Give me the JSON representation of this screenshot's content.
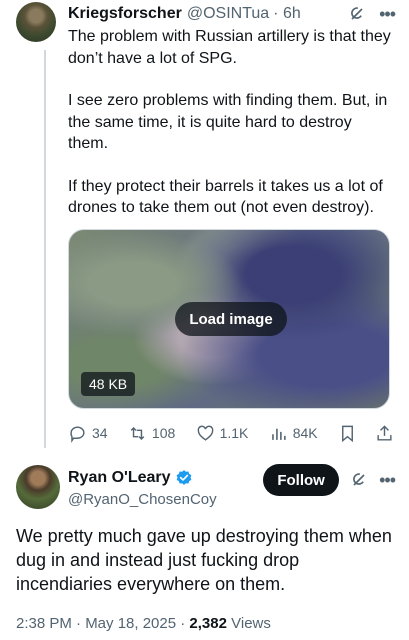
{
  "tweet": {
    "author_name": "Kriegsforscher",
    "author_handle": "@OSINTua",
    "time": "· 6h",
    "paragraphs": [
      "The problem with Russian artillery is that they don’t have a lot of SPG.",
      "I see zero problems with finding them. But, in the same time, it is quite hard to destroy them.",
      "If they protect their barrels it takes us a lot of drones to take them out (not even destroy)."
    ],
    "media": {
      "load_label": "Load image",
      "size": "48 KB"
    },
    "actions": {
      "replies": "34",
      "reposts": "108",
      "likes": "1.1K",
      "views": "84K"
    },
    "icons": [
      "grok-icon",
      "more-icon",
      "reply-icon",
      "repost-icon",
      "like-icon",
      "views-icon",
      "bookmark-icon",
      "share-icon"
    ]
  },
  "reply": {
    "author_name": "Ryan O'Leary",
    "author_handle": "@RyanO_ChosenCoy",
    "follow_label": "Follow",
    "text": "We pretty much gave up destroying them when dug in and instead just fucking drop incendiaries everywhere on them.",
    "meta_time": "2:38 PM · May 18, 2025 · ",
    "meta_views_count": "2,382",
    "meta_views_label": " Views"
  },
  "colors": {
    "text": "#0f1419",
    "secondary": "#536471",
    "verified": "#1d9bf0",
    "border": "#cfd9de"
  }
}
